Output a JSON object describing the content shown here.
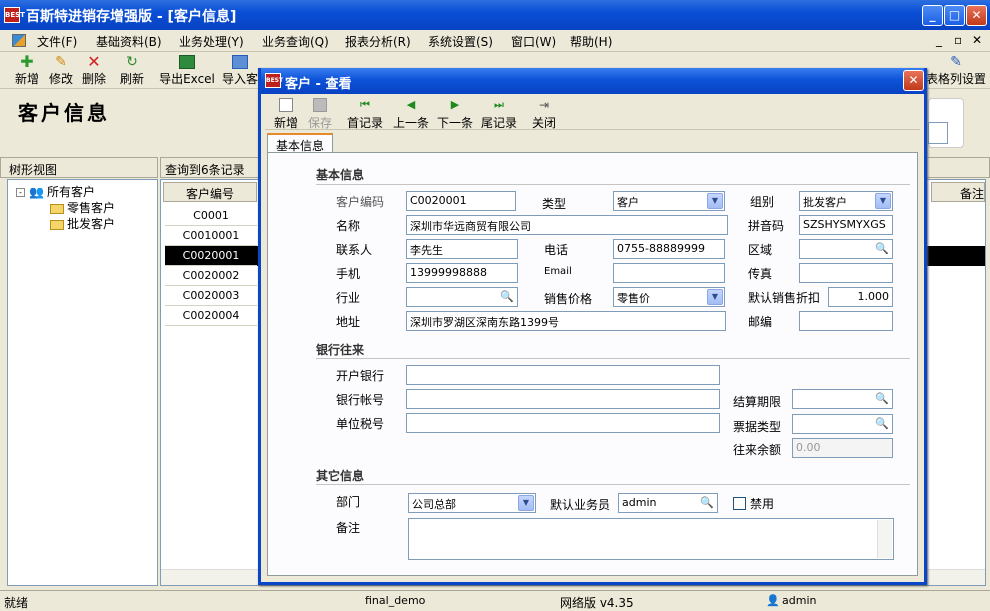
{
  "window": {
    "title": "百斯特进销存增强版 - [客户信息]",
    "logo": "BEST"
  },
  "menu": [
    "文件(F)",
    "基础资料(B)",
    "业务处理(Y)",
    "业务查询(Q)",
    "报表分析(R)",
    "系统设置(S)",
    "窗口(W)",
    "帮助(H)"
  ],
  "toolbar": {
    "add": "新增",
    "edit": "修改",
    "delete": "删除",
    "refresh": "刷新",
    "export": "导出Excel",
    "import": "导入客",
    "grid_settings": "表格列设置"
  },
  "page_title": "客户信息",
  "tree": {
    "header": "树形视图",
    "root": "所有客户",
    "children": [
      "零售客户",
      "批发客户"
    ]
  },
  "grid": {
    "count_label": "查询到6条记录",
    "col_code": "客户编号",
    "col_remark": "备注",
    "rows": [
      "C0001",
      "C0010001",
      "C0020001",
      "C0020002",
      "C0020003",
      "C0020004"
    ],
    "selected_row": "C0020001"
  },
  "status": {
    "left": "就绪",
    "db": "final_demo",
    "version": "网络版 v4.35",
    "user": "admin"
  },
  "dialog": {
    "title": "客户 - 查看",
    "toolbar": {
      "add": "新增",
      "save": "保存",
      "first": "首记录",
      "prev": "上一条",
      "next": "下一条",
      "last": "尾记录",
      "close": "关闭"
    },
    "tab": "基本信息",
    "basic": {
      "section": "基本信息",
      "code_label": "客户编码",
      "code": "C0020001",
      "type_label": "类型",
      "type": "客户",
      "group_label": "组别",
      "group": "批发客户",
      "name_label": "名称",
      "name": "深圳市华远商贸有限公司",
      "pinyin_label": "拼音码",
      "pinyin": "SZSHYSMYXGS",
      "contact_label": "联系人",
      "contact": "李先生",
      "phone_label": "电话",
      "phone": "0755-88889999",
      "area_label": "区域",
      "area": "",
      "mobile_label": "手机",
      "mobile": "13999998888",
      "email_label": "Email",
      "email": "",
      "fax_label": "传真",
      "fax": "",
      "industry_label": "行业",
      "industry": "",
      "price_label": "销售价格",
      "price": "零售价",
      "discount_label": "默认销售折扣",
      "discount": "1.000",
      "address_label": "地址",
      "address": "深圳市罗湖区深南东路1399号",
      "zip_label": "邮编",
      "zip": ""
    },
    "bank": {
      "section": "银行往来",
      "bank_label": "开户银行",
      "bank": "",
      "account_label": "银行帐号",
      "account": "",
      "tax_label": "单位税号",
      "tax": "",
      "settle_label": "结算期限",
      "settle": "",
      "invoice_label": "票据类型",
      "invoice": "",
      "balance_label": "往来余额",
      "balance": "0.00"
    },
    "other": {
      "section": "其它信息",
      "dept_label": "部门",
      "dept": "公司总部",
      "salesman_label": "默认业务员",
      "salesman": "admin",
      "disabled_label": "禁用",
      "remark_label": "备注",
      "remark": ""
    }
  }
}
